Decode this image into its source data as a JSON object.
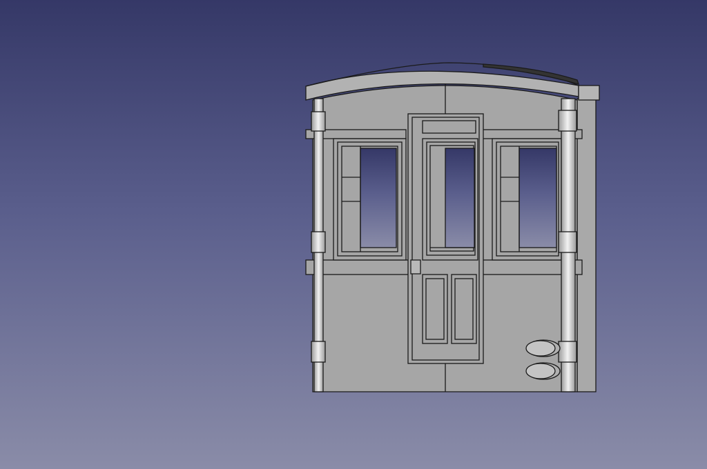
{
  "viewport": {
    "background_top": "#353867",
    "background_bottom": "#8a8ca8"
  },
  "model": {
    "face_color": "#a6a6a6",
    "roof_color": "#b0b0b0",
    "edge_color": "#1a1a1a",
    "glass_color": "background",
    "components": [
      "roof",
      "end-wall",
      "side-wall",
      "door",
      "left-window",
      "door-window",
      "right-window",
      "handrail-left",
      "handrail-right",
      "buffer-lamp-upper",
      "buffer-lamp-lower"
    ]
  }
}
